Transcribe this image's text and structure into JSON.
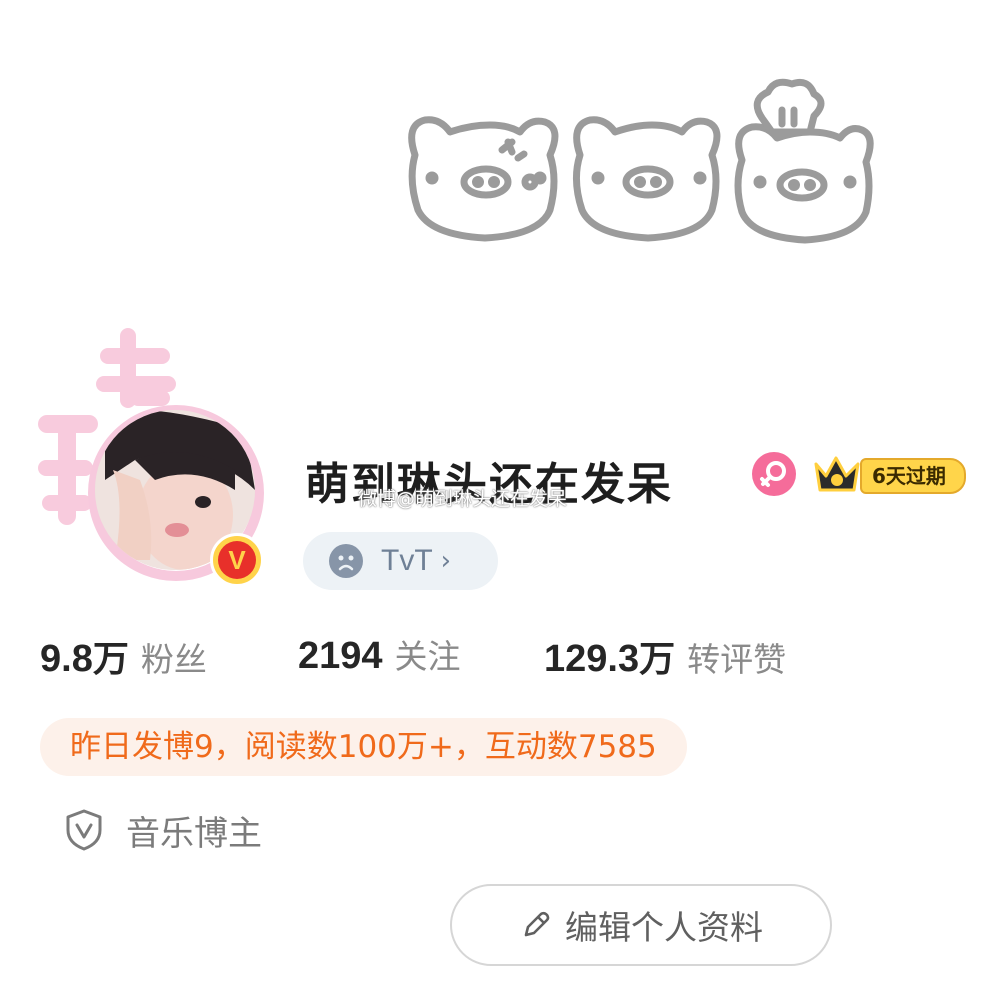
{
  "cover": {
    "decoration": "three-pig-doodles"
  },
  "avatar": {
    "frame_icon": "pink-character-frame",
    "badge_text": "V",
    "badge_color": "#e8302a"
  },
  "profile": {
    "name": "萌到琳头还在发呆",
    "watermark": "微博@萌到琳头还在发呆",
    "gender_icon": "female-icon",
    "vip_label": "6天过期"
  },
  "mood": {
    "icon": "sad-face-icon",
    "text": "TvT",
    "chevron": "›"
  },
  "stats": [
    {
      "num": "9.8",
      "unit": "万",
      "label": "粉丝"
    },
    {
      "num": "2194",
      "unit": "",
      "label": "关注"
    },
    {
      "num": "129.3",
      "unit": "万",
      "label": "转评赞"
    }
  ],
  "activity": {
    "text": "昨日发博9，阅读数100万+，互动数7585",
    "color": "#f06a1b"
  },
  "tag": {
    "icon": "shield-v-icon",
    "text": "音乐博主"
  },
  "edit_button": {
    "icon": "pencil-icon",
    "label": "编辑个人资料"
  }
}
